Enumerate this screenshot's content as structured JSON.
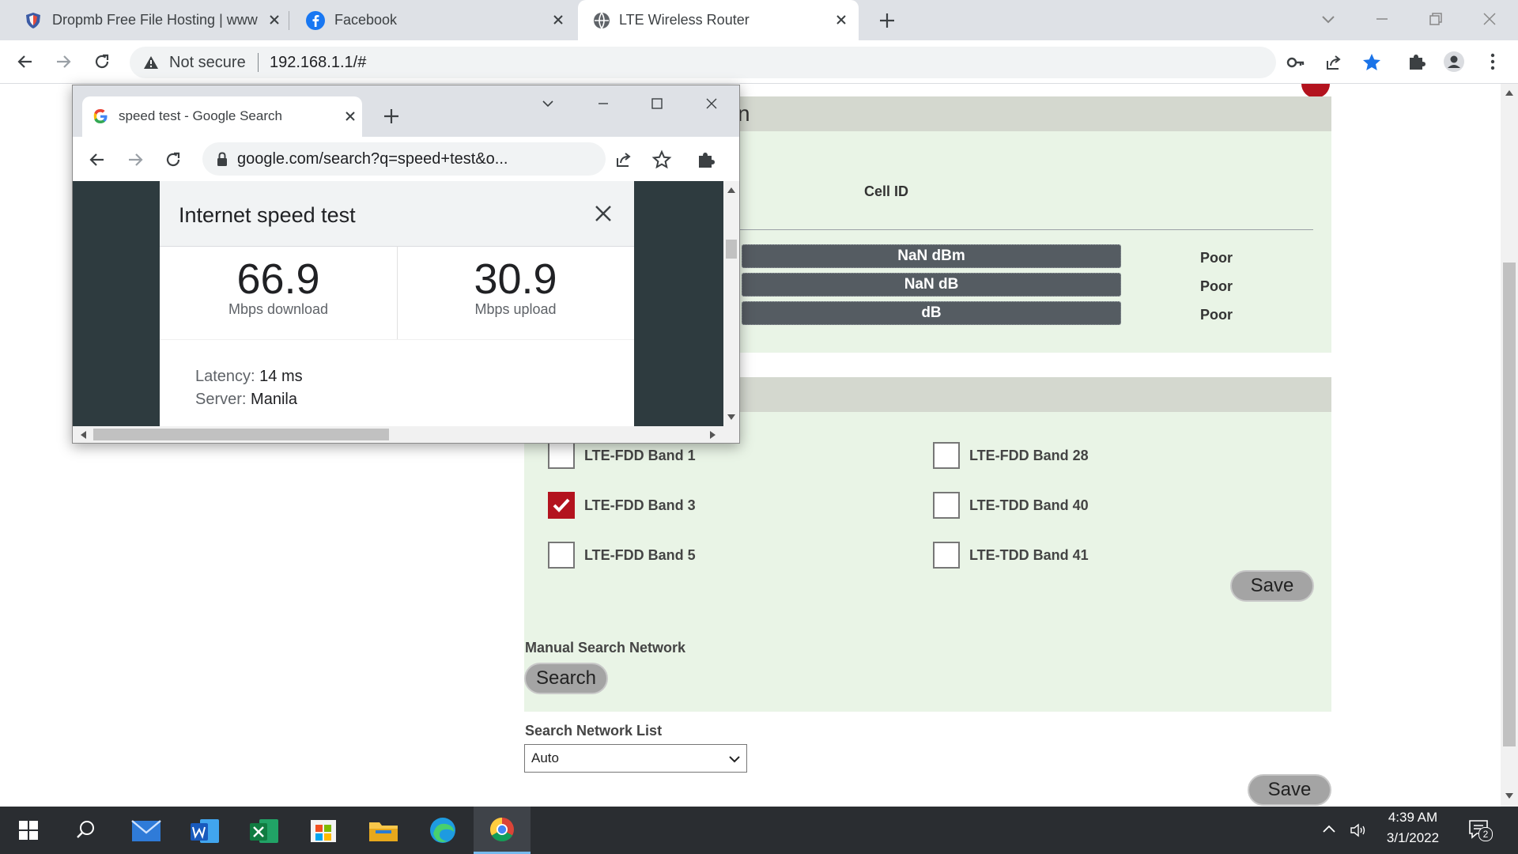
{
  "browser": {
    "tabs": [
      {
        "title": "Dropmb Free File Hosting | www",
        "icon": "dropmb-shield-icon",
        "active": false
      },
      {
        "title": "Facebook",
        "icon": "facebook-icon",
        "active": false
      },
      {
        "title": "LTE Wireless Router",
        "icon": "globe-icon",
        "active": true
      }
    ],
    "security_label": "Not secure",
    "url": "192.168.1.1/#"
  },
  "router": {
    "section_header_fragment": "n",
    "cell_id_label": "Cell ID",
    "signals": [
      {
        "value": "NaN dBm",
        "quality": "Poor"
      },
      {
        "value": "NaN dB",
        "quality": "Poor"
      },
      {
        "value": "dB",
        "quality": "Poor"
      }
    ],
    "bands": [
      {
        "label": "LTE-FDD Band 1",
        "checked": false
      },
      {
        "label": "LTE-FDD Band 3",
        "checked": true
      },
      {
        "label": "LTE-FDD Band 5",
        "checked": false
      },
      {
        "label": "LTE-FDD Band 28",
        "checked": false
      },
      {
        "label": "LTE-TDD Band 40",
        "checked": false
      },
      {
        "label": "LTE-TDD Band 41",
        "checked": false
      }
    ],
    "band_save_label": "Save",
    "manual_search_label": "Manual Search Network",
    "search_button_label": "Search",
    "network_list_label": "Search Network List",
    "network_list_value": "Auto",
    "bottom_save_label": "Save",
    "accent_color": "#b3131e"
  },
  "popup": {
    "tab_title": "speed test - Google Search",
    "url": "google.com/search?q=speed+test&o...",
    "speed_test": {
      "title": "Internet speed test",
      "download_value": "66.9",
      "download_unit": "Mbps download",
      "upload_value": "30.9",
      "upload_unit": "Mbps upload",
      "latency_label": "Latency:",
      "latency_value": "14 ms",
      "server_label": "Server:",
      "server_value": "Manila"
    }
  },
  "taskbar": {
    "apps": [
      "start-icon",
      "search-icon",
      "mail-icon",
      "word-icon",
      "excel-icon",
      "store-icon",
      "file-explorer-icon",
      "edge-icon",
      "chrome-icon"
    ],
    "time": "4:39 AM",
    "date": "3/1/2022",
    "notification_count": "2"
  }
}
